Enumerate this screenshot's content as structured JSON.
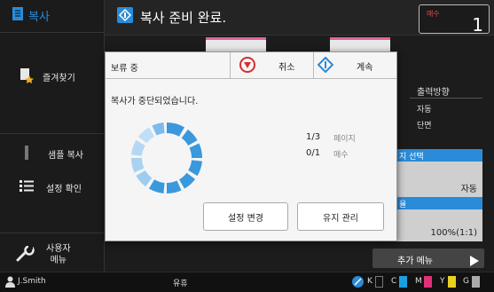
{
  "sidebar": {
    "title": "복사",
    "items": [
      {
        "label": "즐겨찾기",
        "icon": "favorite-doc-icon"
      },
      {
        "label": "샘플 복사",
        "icon": "sample-bar-icon"
      },
      {
        "label": "설정 확인",
        "icon": "list-icon"
      },
      {
        "label": "사용자\n메뉴",
        "icon": "wrench-icon"
      }
    ]
  },
  "header": {
    "title": "복사 준비 완료.",
    "counter_label": "매수",
    "counter_value": "1"
  },
  "background": {
    "output_direction_label": "출력방향",
    "output_auto": "자동",
    "output_simplex": "단면",
    "paper_select_label": "지 선택",
    "paper_select_value": "자동",
    "ratio_label": "율",
    "ratio_value": "100%(1:1)",
    "more_menu": "추가 메뉴"
  },
  "dialog": {
    "title": "보류 중",
    "cancel_label": "취소",
    "continue_label": "계속",
    "message": "복사가 중단되었습니다.",
    "pages_current": "1/3",
    "pages_label": "페이지",
    "copies_current": "0/1",
    "copies_label": "매수",
    "change_settings_label": "설정 변경",
    "maintenance_label": "유지 관리"
  },
  "status": {
    "user": "J.Smith",
    "state": "유휴",
    "ink": [
      {
        "name": "K",
        "color": "#111111"
      },
      {
        "name": "C",
        "color": "#1aa0e0"
      },
      {
        "name": "M",
        "color": "#e0307a"
      },
      {
        "name": "Y",
        "color": "#e8d020"
      },
      {
        "name": "G",
        "color": "#8a8a8a"
      }
    ]
  },
  "colors": {
    "accent": "#2a8bd8",
    "cancel_red": "#d23030"
  }
}
